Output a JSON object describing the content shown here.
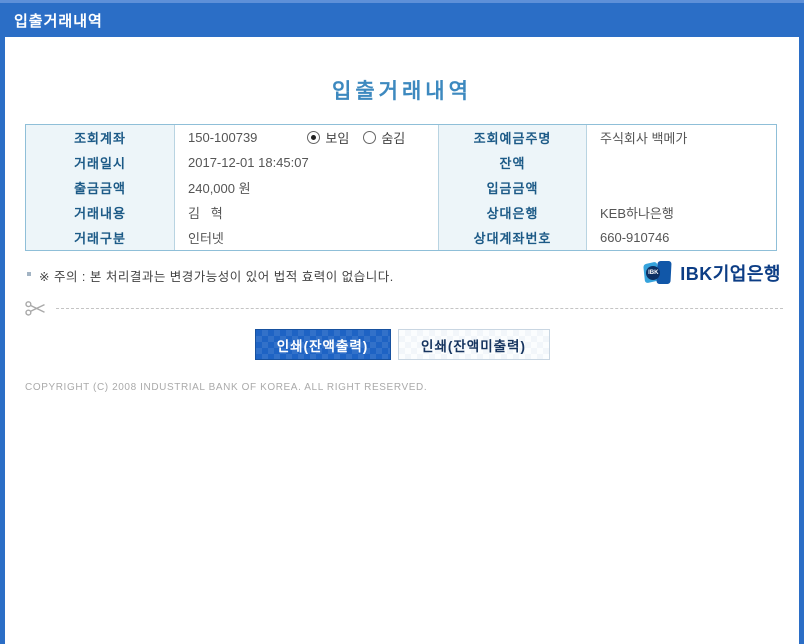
{
  "header": {
    "title": "입출거래내역"
  },
  "page": {
    "title": "입출거래내역"
  },
  "table": {
    "left_rows": [
      {
        "label": "조회계좌",
        "value": "150-100739"
      },
      {
        "label": "거래일시",
        "value": "2017-12-01 18:45:07"
      },
      {
        "label": "출금금액",
        "value": "240,000 원"
      },
      {
        "label": "거래내용",
        "value": "김   혁"
      },
      {
        "label": "거래구분",
        "value": "인터넷"
      }
    ],
    "right_rows": [
      {
        "label": "조회예금주명",
        "value": "주식회사 백메가"
      },
      {
        "label": "잔액",
        "value": ""
      },
      {
        "label": "입금금액",
        "value": ""
      },
      {
        "label": "상대은행",
        "value": "KEB하나은행"
      },
      {
        "label": "상대계좌번호",
        "value": "660-910746"
      }
    ],
    "radios": {
      "show_label": "보임",
      "hide_label": "숨김",
      "selected": "보임"
    }
  },
  "notice": {
    "text": "※ 주의 : 본 처리결과는 변경가능성이 있어 법적 효력이 없습니다."
  },
  "logo": {
    "mark_text": "IBK",
    "bank_name": "IBK기업은행"
  },
  "buttons": {
    "print_with_balance": "인쇄(잔액출력)",
    "print_without_balance": "인쇄(잔액미출력)"
  },
  "footer": {
    "copyright": "COPYRIGHT (C) 2008 INDUSTRIAL BANK OF KOREA. ALL RIGHT RESERVED."
  },
  "colors": {
    "header_blue": "#2b6ec6",
    "title_blue": "#3d89bf",
    "table_border": "#8fbfd8",
    "label_bg": "#edf5f9",
    "label_text": "#1c5a87",
    "primary_button_blue": "#1e63c4",
    "logo_navy": "#0c3d85"
  }
}
